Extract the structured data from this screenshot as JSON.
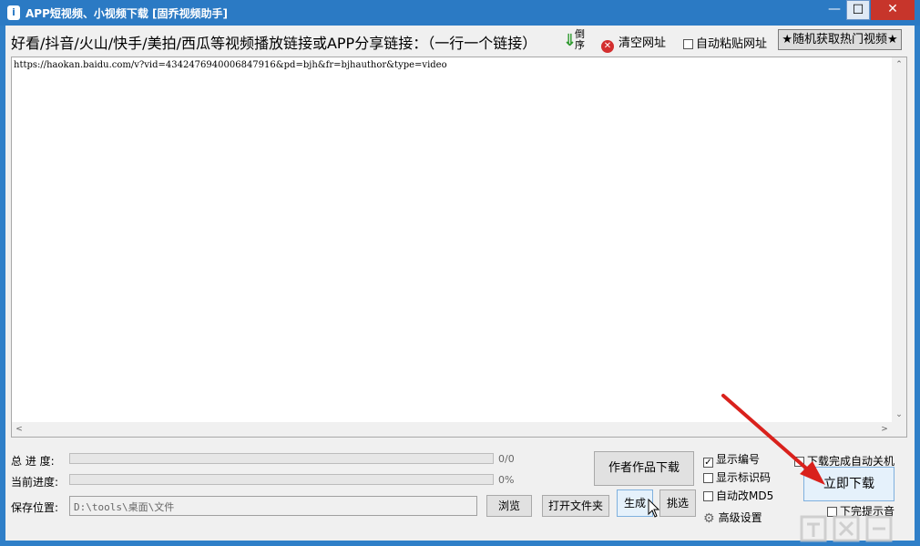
{
  "window": {
    "title": "APP短视频、小视频下载 [固乔视频助手]",
    "app_icon_glyph": "i",
    "minimize_glyph": "—",
    "maximize_glyph": "☐",
    "close_glyph": "✕"
  },
  "toolbar": {
    "prompt": "好看/抖音/火山/快手/美拍/西瓜等视频播放链接或APP分享链接：（一行一个链接）",
    "reverse_label": "倒序",
    "reverse_icon_glyph": "⇓",
    "clear_label": "清空网址",
    "clear_icon_glyph": "✕",
    "auto_paste_label": "自动粘贴网址",
    "auto_paste_checked": false,
    "random_label": "★随机获取热门视频★"
  },
  "url_box": {
    "content": "https://haokan.baidu.com/v?vid=4342476940006847916&pd=bjh&fr=bjhauthor&type=video",
    "scroll_up": "⌃",
    "scroll_down": "⌄",
    "scroll_left": "<",
    "scroll_right": ">"
  },
  "progress": {
    "total_label": "总 进 度:",
    "total_value": "0/0",
    "total_fraction": 0,
    "current_label": "当前进度:",
    "current_value": "0%",
    "current_fraction": 0
  },
  "save": {
    "label": "保存位置:",
    "path": "D:\\tools\\桌面\\文件",
    "browse_label": "浏览",
    "open_folder_label": "打开文件夹"
  },
  "actions": {
    "author_download_label": "作者作品下载",
    "generate_label": "生成",
    "pick_label": "挑选",
    "download_now_label": "立即下载"
  },
  "options": {
    "show_number": {
      "label": "显示编号",
      "checked": true
    },
    "show_id": {
      "label": "显示标识码",
      "checked": false
    },
    "auto_md5": {
      "label": "自动改MD5",
      "checked": false
    },
    "advanced_label": "高级设置",
    "advanced_icon_glyph": "⚙",
    "auto_shutdown": {
      "label": "下载完成自动关机",
      "checked": false
    },
    "done_sound": {
      "label": "下完提示音",
      "checked": false
    }
  },
  "colors": {
    "title_bar": "#2b7ac4",
    "close_button": "#c7352b",
    "annotation_arrow": "#d9211c",
    "reverse_arrow": "#2f9a2f"
  }
}
